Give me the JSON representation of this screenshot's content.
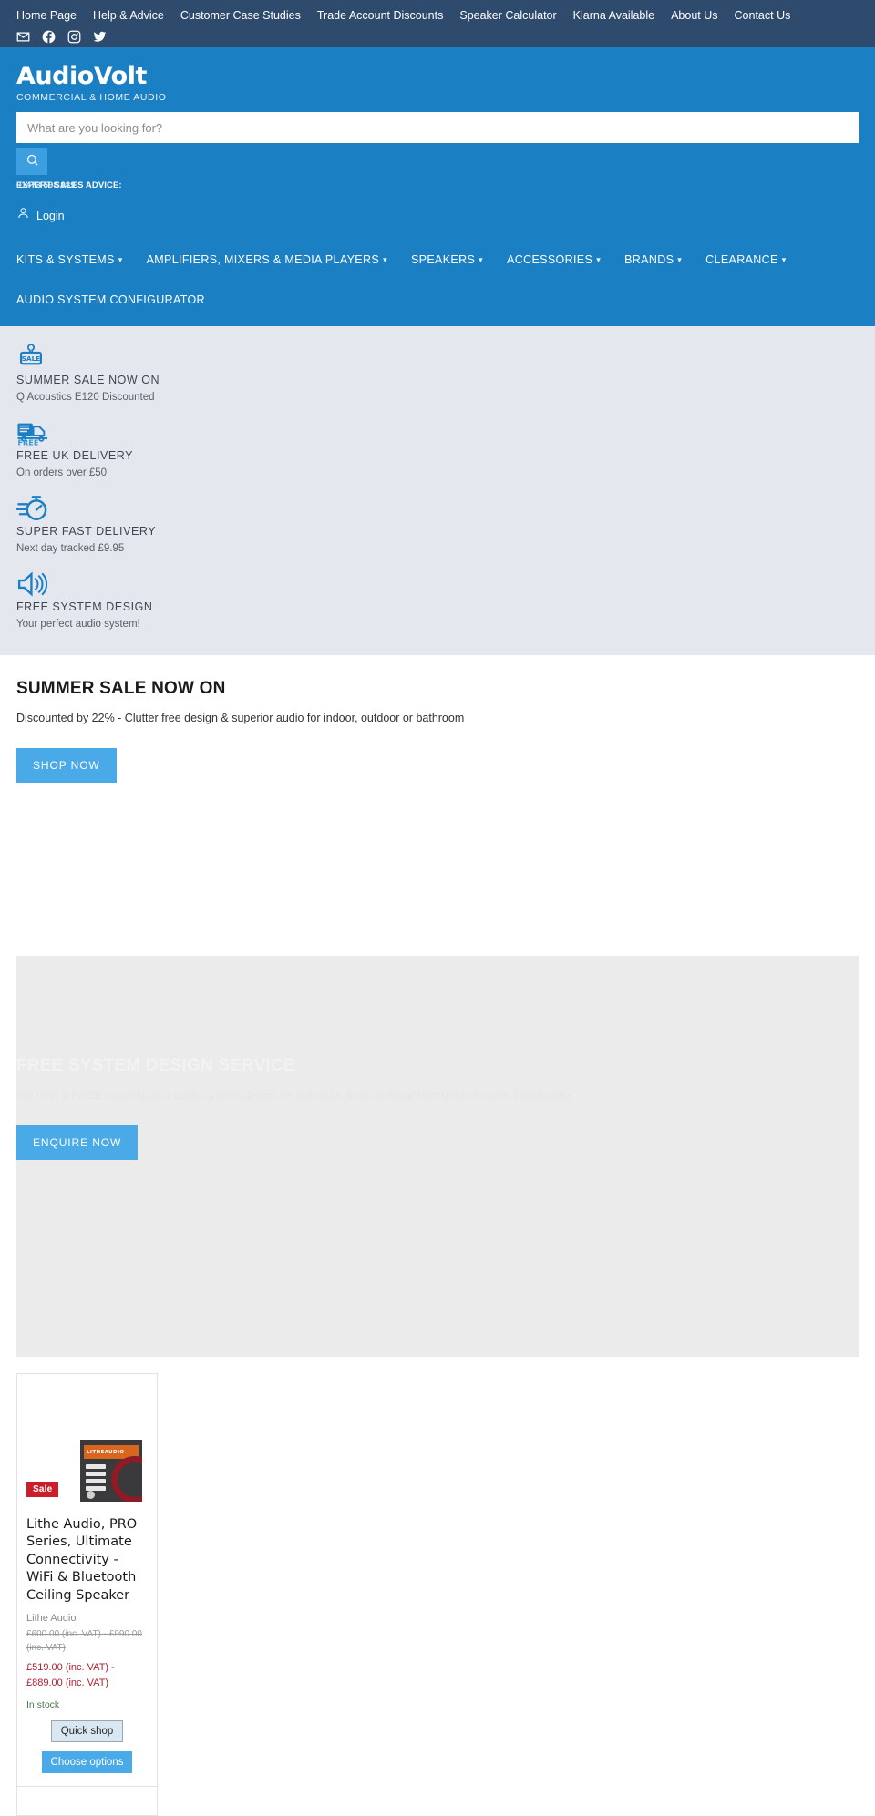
{
  "topbar": {
    "links": [
      {
        "label": "Home Page",
        "name": "home-page"
      },
      {
        "label": "Help & Advice",
        "name": "help-advice"
      },
      {
        "label": "Customer Case Studies",
        "name": "customer-case-studies"
      },
      {
        "label": "Trade Account Discounts",
        "name": "trade-account-discounts"
      },
      {
        "label": "Speaker Calculator",
        "name": "speaker-calculator"
      },
      {
        "label": "Klarna Available",
        "name": "klarna-available"
      },
      {
        "label": "About Us",
        "name": "about-us"
      },
      {
        "label": "Contact Us",
        "name": "contact-us"
      }
    ],
    "social": [
      "email-icon",
      "facebook-icon",
      "instagram-icon",
      "twitter-icon"
    ],
    "bg_color": "#2e4b6e"
  },
  "header": {
    "logo_text": "AudioVolt",
    "logo_tagline": "COMMERCIAL & HOME AUDIO",
    "bg_color": "#1b7fc4",
    "search": {
      "placeholder": "What are you looking for?",
      "value": "",
      "button_icon": "search-icon"
    },
    "cart_icon": "shopping-cart-icon",
    "advice_line_a": "EXPERT SALES ADVICE:",
    "advice_line_b": "01473 598 989",
    "account": {
      "label": "Login",
      "icon": "user-icon"
    },
    "nav": [
      {
        "label": "KITS & SYSTEMS",
        "has_dropdown": true,
        "name": "kits-systems"
      },
      {
        "label": "AMPLIFIERS, MIXERS & MEDIA PLAYERS",
        "has_dropdown": true,
        "name": "amplifiers-mixers-media-players"
      },
      {
        "label": "SPEAKERS",
        "has_dropdown": true,
        "name": "speakers"
      },
      {
        "label": "ACCESSORIES",
        "has_dropdown": true,
        "name": "accessories"
      },
      {
        "label": "BRANDS",
        "has_dropdown": true,
        "name": "brands"
      },
      {
        "label": "CLEARANCE",
        "has_dropdown": true,
        "name": "clearance"
      }
    ],
    "nav_secondary": [
      {
        "label": "AUDIO SYSTEM CONFIGURATOR",
        "has_dropdown": false,
        "name": "audio-system-configurator"
      }
    ]
  },
  "benefits": {
    "bg_color": "#e4e7ee",
    "accent_color": "#1b7fc4",
    "items": [
      {
        "icon": "sale-tag-icon",
        "title": "SUMMER SALE NOW ON",
        "sub": "Q Acoustics E120 Discounted"
      },
      {
        "icon": "delivery-truck-icon",
        "title": "FREE UK DELIVERY",
        "sub": "On orders over £50"
      },
      {
        "icon": "stopwatch-icon",
        "title": "SUPER FAST DELIVERY",
        "sub": "Next day tracked £9.95"
      },
      {
        "icon": "speaker-volume-icon",
        "title": "FREE SYSTEM DESIGN",
        "sub": "Your perfect audio system!"
      }
    ]
  },
  "hero": [
    {
      "title": "SUMMER SALE NOW ON",
      "sub": "Discounted by 22% - Clutter free design & superior audio for indoor, outdoor or bathroom",
      "cta": "SHOP NOW",
      "cta_color": "#4aaae8",
      "name": "hero-summer-sale"
    },
    {
      "title": "FREE SYSTEM DESIGN SERVICE",
      "sub": "We offer a FREE no obligation audio system design for domestic & commercial background music installations",
      "cta": "ENQUIRE NOW",
      "cta_color": "#4aaae8",
      "name": "hero-system-design"
    }
  ],
  "products": [
    {
      "badge": "Sale",
      "badge_color": "#cc1d2b",
      "title": "Lithe Audio, PRO Series, Ultimate Connectivity - WiFi & Bluetooth Ceiling Speaker",
      "vendor": "Lithe Audio",
      "price_old": "£600.00 (inc. VAT) - £990.00 (inc. VAT)",
      "price_new": "£519.00 (inc. VAT) - £889.00 (inc. VAT)",
      "price_color": "#b02030",
      "stock": "In stock",
      "image_brand": "LITHEAUDIO",
      "quick_shop_label": "Quick shop",
      "choose_options_label": "Choose options"
    }
  ]
}
